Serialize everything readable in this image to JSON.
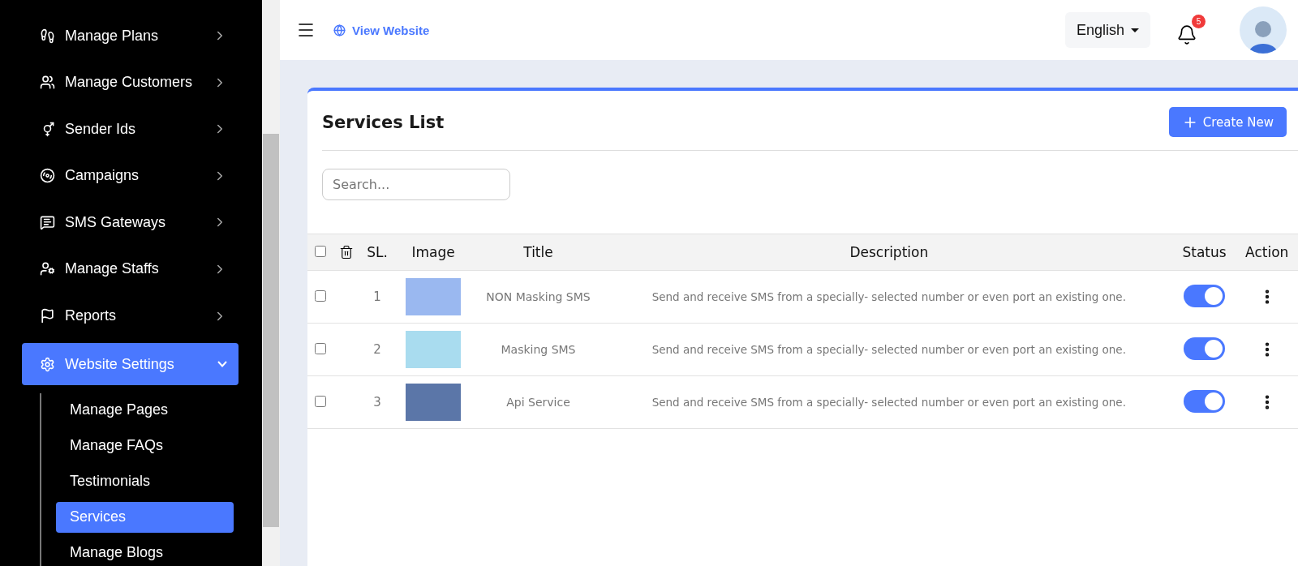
{
  "sidebar": {
    "items": [
      {
        "label": "Manage Plans",
        "selected": false,
        "expanded": false
      },
      {
        "label": "Manage Customers",
        "selected": false,
        "expanded": false
      },
      {
        "label": "Sender Ids",
        "selected": false,
        "expanded": false
      },
      {
        "label": "Campaigns",
        "selected": false,
        "expanded": false
      },
      {
        "label": "SMS Gateways",
        "selected": false,
        "expanded": false
      },
      {
        "label": "Manage Staffs",
        "selected": false,
        "expanded": false
      },
      {
        "label": "Reports",
        "selected": false,
        "expanded": false
      },
      {
        "label": "Website Settings",
        "selected": true,
        "expanded": true,
        "children": [
          {
            "label": "Manage Pages",
            "selected": false
          },
          {
            "label": "Manage FAQs",
            "selected": false
          },
          {
            "label": "Testimonials",
            "selected": false
          },
          {
            "label": "Services",
            "selected": true
          },
          {
            "label": "Manage Blogs",
            "selected": false
          }
        ]
      }
    ]
  },
  "header": {
    "view_website": "View Website",
    "language": "English",
    "notifications": "5"
  },
  "card": {
    "title": "Services List",
    "create_button": "Create New",
    "search": {
      "placeholder": "Search..."
    },
    "table": {
      "columns": [
        "SL.",
        "Image",
        "Title",
        "Description",
        "Status",
        "Action"
      ],
      "select_all_checked": false,
      "rows": [
        {
          "checked": false,
          "sl": "1",
          "title": "NON Masking SMS",
          "description": "Send and receive SMS from a specially- selected number or even port an existing one.",
          "on": true
        },
        {
          "checked": false,
          "sl": "2",
          "title": "Masking SMS",
          "description": "Send and receive SMS from a specially- selected number or even port an existing one.",
          "on": true
        },
        {
          "checked": false,
          "sl": "3",
          "title": "Api Service",
          "description": "Send and receive SMS from a specially- selected number or even port an existing one.",
          "on": true
        }
      ]
    }
  }
}
